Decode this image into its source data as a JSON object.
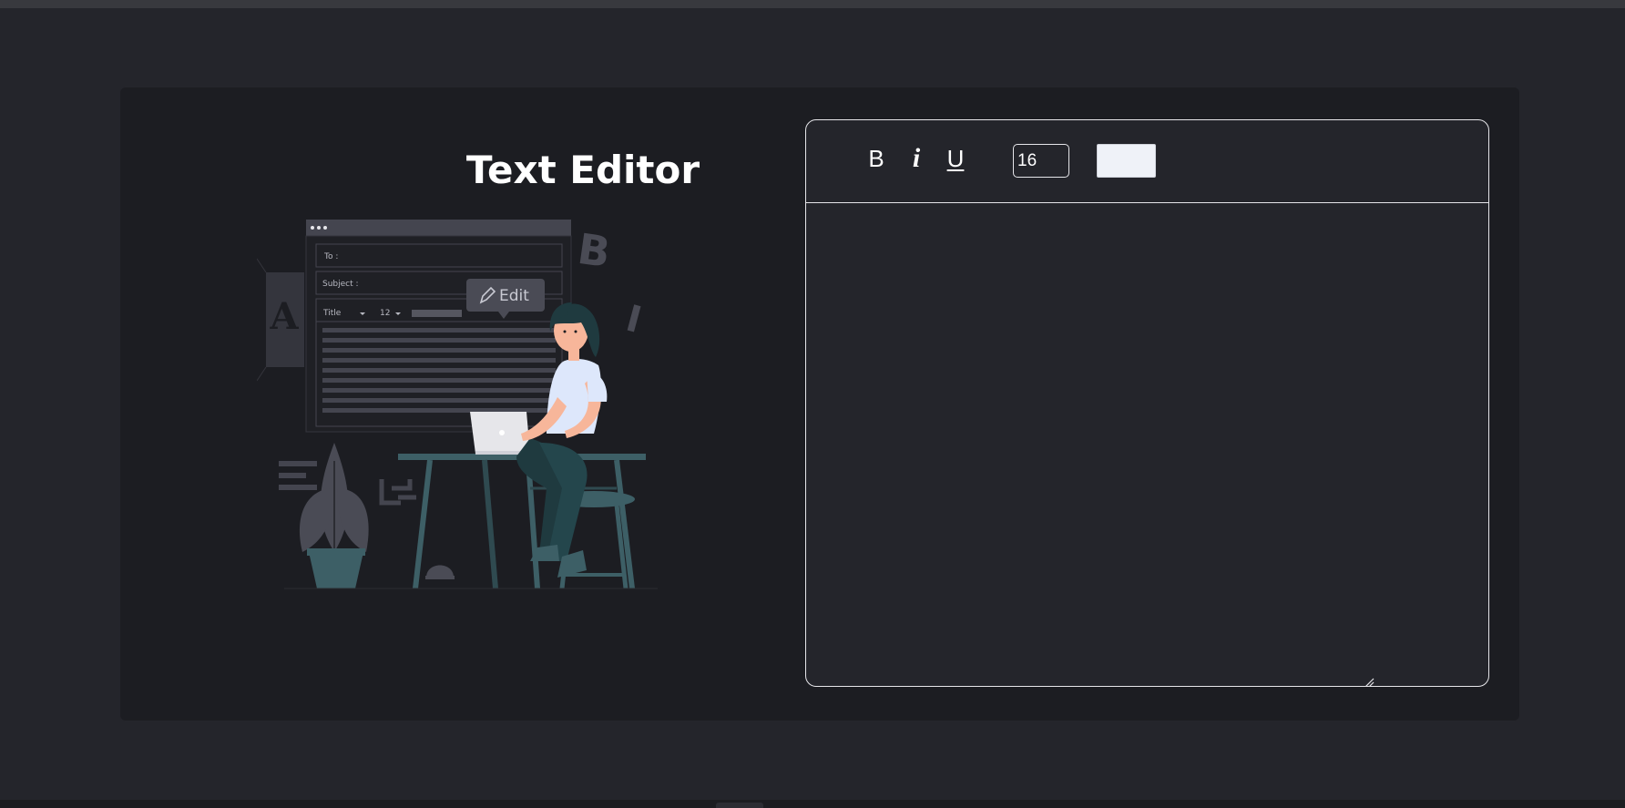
{
  "app": {
    "title": "Text Editor"
  },
  "illustration": {
    "tooltip_label": "Edit",
    "form_to_label": "To :",
    "form_subject_label": "Subject :",
    "toolbar_style": "Title",
    "toolbar_size": "12",
    "deco_letter_b": "B",
    "deco_letter_i": "I",
    "deco_letter_a": "A"
  },
  "editor": {
    "toolbar": {
      "bold_label": "B",
      "italic_label": "i",
      "underline_label": "U",
      "font_size_value": "16",
      "color_value": "#eff2f8"
    },
    "content": ""
  },
  "colors": {
    "page_background": "#24252b",
    "card_background": "#1c1d22",
    "border": "#e6e6ea",
    "text": "#ffffff"
  }
}
